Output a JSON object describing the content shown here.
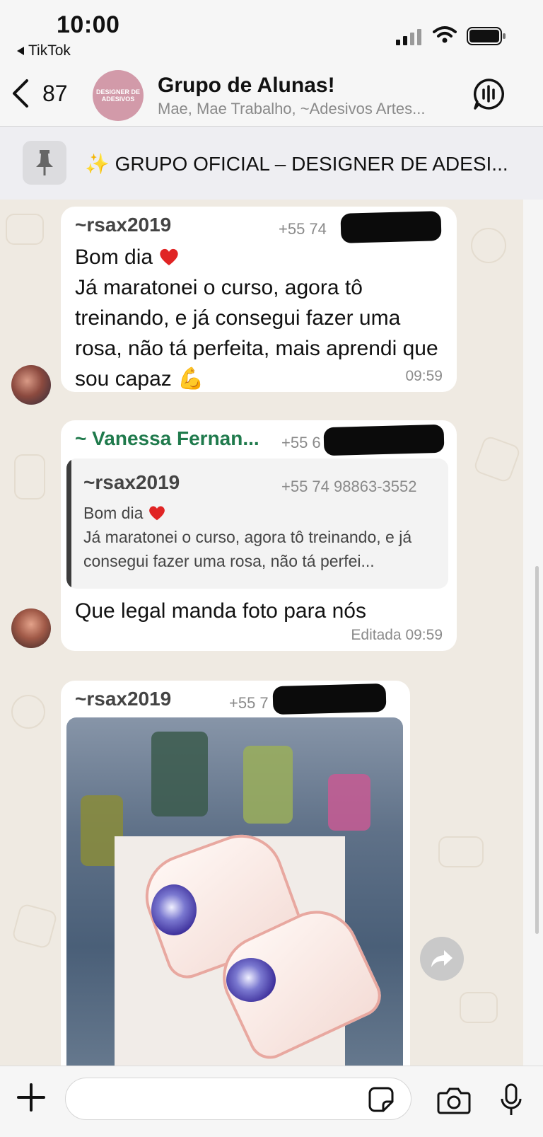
{
  "status_bar": {
    "time": "10:00",
    "back_app": "TikTok"
  },
  "header": {
    "unread_count": "87",
    "avatar_text": "DESIGNER DE ADESIVOS",
    "title": "Grupo de Alunas!",
    "subtitle": "Mae, Mae Trabalho, ~Adesivos Artes..."
  },
  "pinned": {
    "text": "✨ GRUPO OFICIAL – DESIGNER DE ADESI..."
  },
  "messages": [
    {
      "sender": "~rsax2019",
      "phone": "+55 74",
      "line1": "Bom dia",
      "body": "Já maratonei o curso, agora tô treinando, e já consegui fazer uma rosa, não tá perfeita, mais aprendi que sou capaz",
      "emoji": "💪",
      "time": "09:59"
    },
    {
      "sender": "~ Vanessa Fernan...",
      "phone": "+55 6",
      "reply": {
        "sender": "~rsax2019",
        "phone": "+55 74 98863-3552",
        "line1": "Bom dia",
        "body": "Já maratonei o curso, agora tô treinando, e já consegui fazer uma rosa, não tá perfei..."
      },
      "body": "Que legal manda foto para nós",
      "time": "Editada 09:59"
    },
    {
      "sender": "~rsax2019",
      "phone": "+55 7"
    }
  ],
  "icons": [
    "chevron-left-icon",
    "call-wave-icon",
    "pin-icon",
    "forward-icon",
    "plus-icon",
    "sticker-icon",
    "camera-icon",
    "mic-icon"
  ],
  "colors": {
    "bubble": "#ffffff",
    "chat_bg": "#efeae2",
    "sender_green": "#1f7a4c",
    "meta_gray": "#8a8a8a"
  }
}
